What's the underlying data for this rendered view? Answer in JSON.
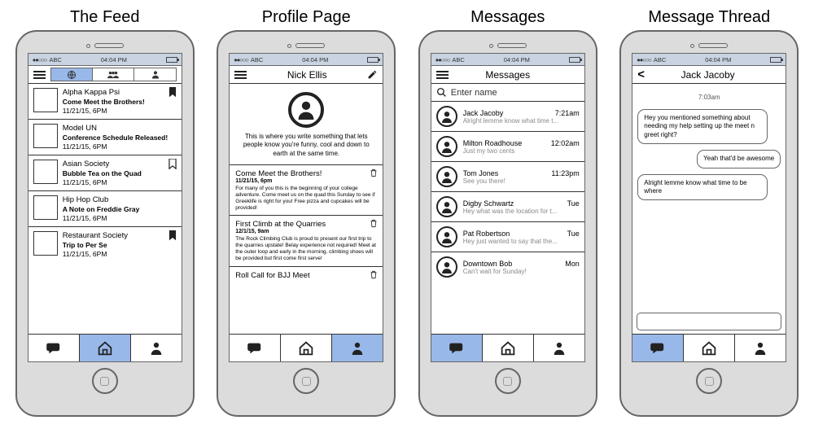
{
  "titles": [
    "The Feed",
    "Profile Page",
    "Messages",
    "Message Thread"
  ],
  "status": {
    "carrier": "ABC",
    "time": "04:04 PM"
  },
  "feed": [
    {
      "org": "Alpha Kappa Psi",
      "title": "Come Meet the Brothers!",
      "dt": "11/21/15, 6PM",
      "bookmarked": true
    },
    {
      "org": "Model UN",
      "title": "Conference Schedule Released!",
      "dt": "11/21/15, 6PM",
      "bookmarked": false
    },
    {
      "org": "Asian Society",
      "title": "Bubble Tea on the Quad",
      "dt": "11/21/15, 6PM",
      "bookmarked": false
    },
    {
      "org": "Hip Hop Club",
      "title": "A Note on Freddie Gray",
      "dt": "11/21/15, 6PM",
      "bookmarked": false
    },
    {
      "org": "Restaurant Society",
      "title": "Trip to Per Se",
      "dt": "11/21/15, 6PM",
      "bookmarked": true
    }
  ],
  "profile": {
    "name": "Nick Ellis",
    "bio": "This is where you write something that lets people know you're funny, cool and down to earth at the same time.",
    "posts": [
      {
        "title": "Come Meet the Brothers!",
        "dt": "11/21/15, 6pm",
        "body": "For many of you this is the beginning of your college adventure. Come meet us on the quad this Sunday to see if Greeklife is right for you! Free pizza and cupcakes will be provided!"
      },
      {
        "title": "First Climb at the Quarries",
        "dt": "12/1/15, 9am",
        "body": "The Rock Climbing Club is proud to present our first trip to the quarries upstate! Belay experience not required! Meet at the outer loop and early in the morning, climbing shoes will be provided but first come first serve!"
      },
      {
        "title": "Roll Call for BJJ Meet",
        "dt": "",
        "body": ""
      }
    ]
  },
  "messages": {
    "header": "Messages",
    "search_placeholder": "Enter name",
    "items": [
      {
        "name": "Jack Jacoby",
        "time": "7:21am",
        "preview": "Alright lemme know what time t..."
      },
      {
        "name": "Milton Roadhouse",
        "time": "12:02am",
        "preview": "Just my two cents"
      },
      {
        "name": "Tom Jones",
        "time": "11:23pm",
        "preview": "See you there!"
      },
      {
        "name": "Digby Schwartz",
        "time": "Tue",
        "preview": "Hey what was the location for t..."
      },
      {
        "name": "Pat Robertson",
        "time": "Tue",
        "preview": "Hey just wanted to say that the..."
      },
      {
        "name": "Downtown Bob",
        "time": "Mon",
        "preview": "Can't wait for Sunday!"
      }
    ]
  },
  "thread": {
    "name": "Jack Jacoby",
    "timestamp": "7:03am",
    "bubbles": [
      {
        "side": "left",
        "text": "Hey you mentioned something about needing my help setting up the meet n greet right?"
      },
      {
        "side": "right",
        "text": "Yeah that'd be awesome"
      },
      {
        "side": "left",
        "text": "Alright lemme know what time to be where"
      }
    ]
  }
}
